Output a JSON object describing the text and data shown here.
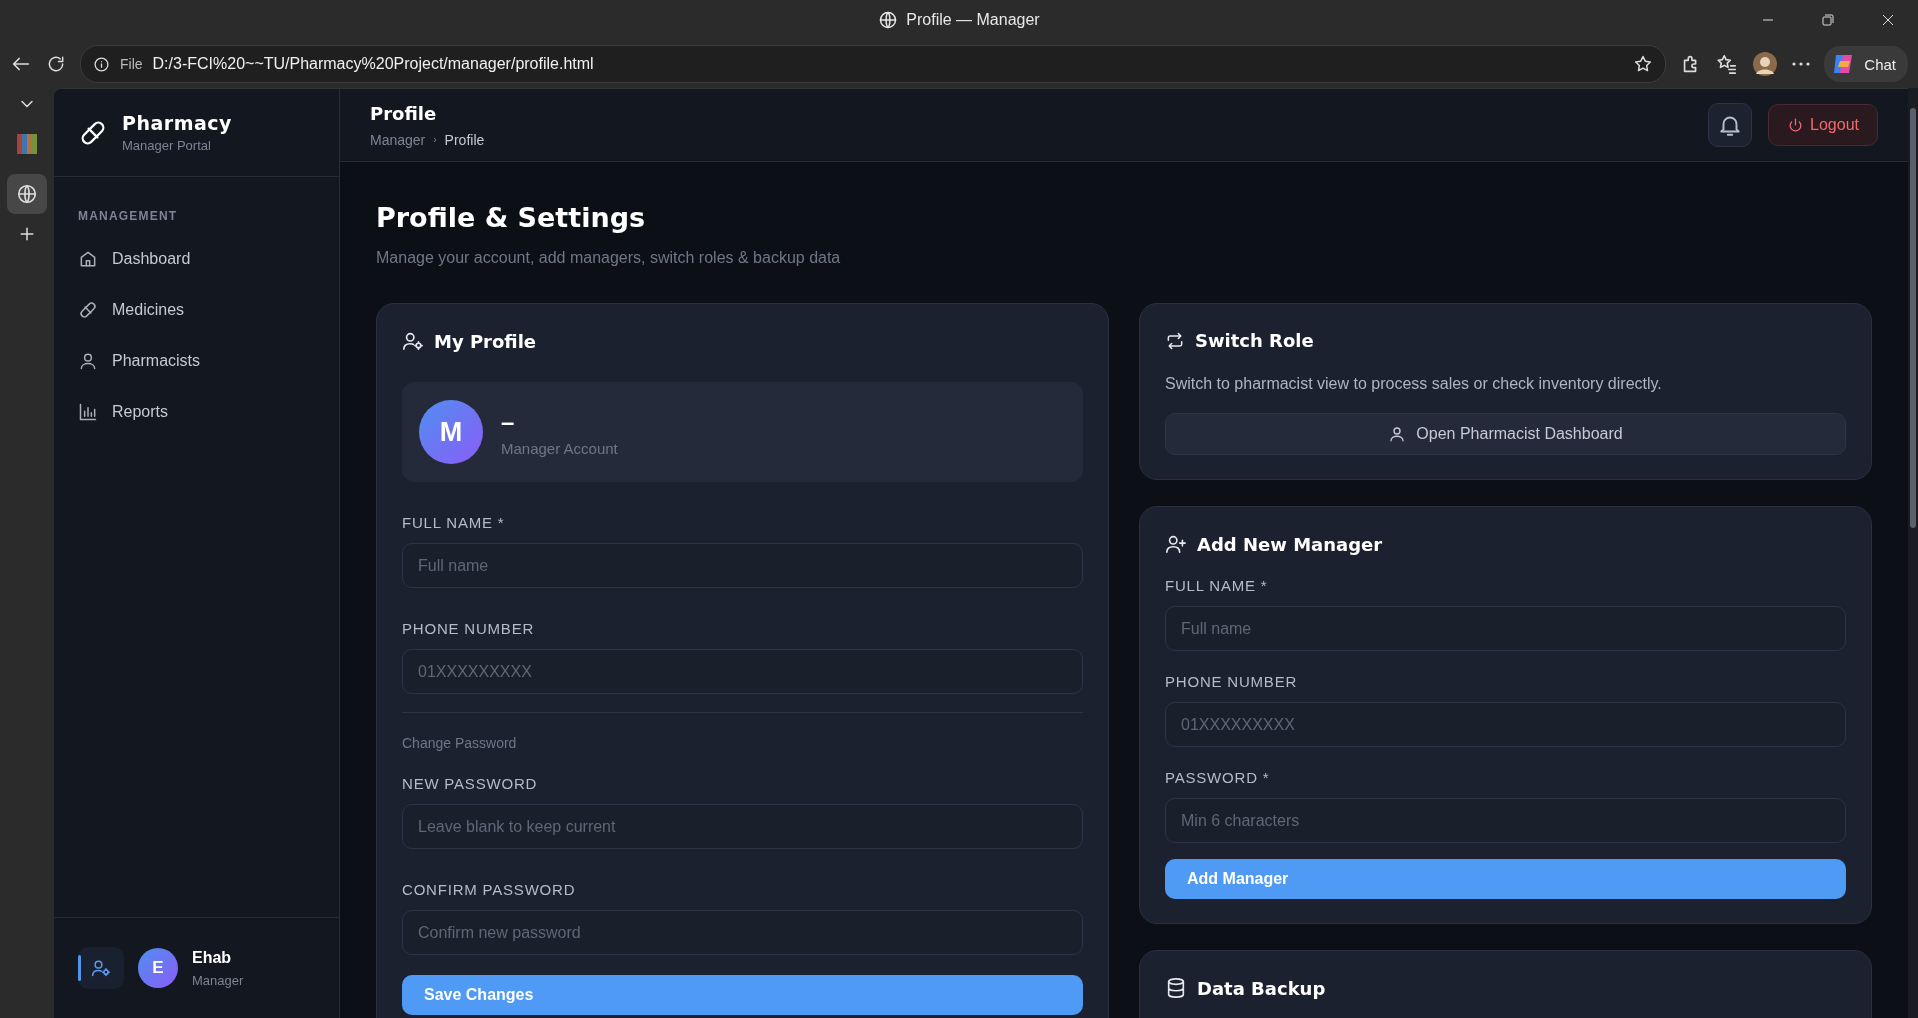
{
  "browser": {
    "title": "Profile — Manager",
    "scheme": "File",
    "url": "D:/3-FCI%20~~TU/Pharmacy%20Project/manager/profile.html",
    "chat_label": "Chat",
    "vertical_tabs": [
      {
        "kind": "favicon",
        "selected": false
      },
      {
        "kind": "globe",
        "selected": true
      }
    ]
  },
  "sidebar": {
    "brand": {
      "name": "Pharmacy",
      "subtitle": "Manager Portal"
    },
    "section_label": "MANAGEMENT",
    "items": [
      {
        "label": "Dashboard",
        "kind": "home",
        "selected": false
      },
      {
        "label": "Medicines",
        "kind": "pill",
        "selected": false
      },
      {
        "label": "Pharmacists",
        "kind": "user",
        "selected": false
      },
      {
        "label": "Reports",
        "kind": "chart",
        "selected": false
      }
    ],
    "user": {
      "initial": "E",
      "name": "Ehab",
      "role": "Manager"
    }
  },
  "topbar": {
    "title": "Profile",
    "breadcrumb": [
      "Manager",
      "Profile"
    ],
    "breadcrumb_separator": "›",
    "logout": "Logout"
  },
  "page": {
    "title": "Profile & Settings",
    "subtitle": "Manage your account, add managers, switch roles & backup data"
  },
  "profile_card": {
    "title": "My Profile",
    "avatar_initial": "M",
    "name": "–",
    "account_type": "Manager Account",
    "fields": [
      {
        "label": "FULL NAME *",
        "placeholder": "Full name"
      },
      {
        "label": "PHONE NUMBER",
        "placeholder": "01XXXXXXXXX"
      }
    ],
    "password_heading": "Change Password",
    "password_fields": [
      {
        "label": "NEW PASSWORD",
        "placeholder": "Leave blank to keep current"
      },
      {
        "label": "CONFIRM PASSWORD",
        "placeholder": "Confirm new password"
      }
    ],
    "button": "Save Changes"
  },
  "switch_role": {
    "title": "Switch Role",
    "text": "Switch to pharmacist view to process sales or check inventory directly.",
    "button": "Open Pharmacist Dashboard"
  },
  "add_manager": {
    "title": "Add New Manager",
    "fields": [
      {
        "label": "FULL NAME *",
        "placeholder": "Full name"
      },
      {
        "label": "PHONE NUMBER",
        "placeholder": "01XXXXXXXXX"
      },
      {
        "label": "PASSWORD *",
        "placeholder": "Min 6 characters"
      }
    ],
    "button": "Add Manager"
  },
  "backup": {
    "title": "Data Backup"
  }
}
